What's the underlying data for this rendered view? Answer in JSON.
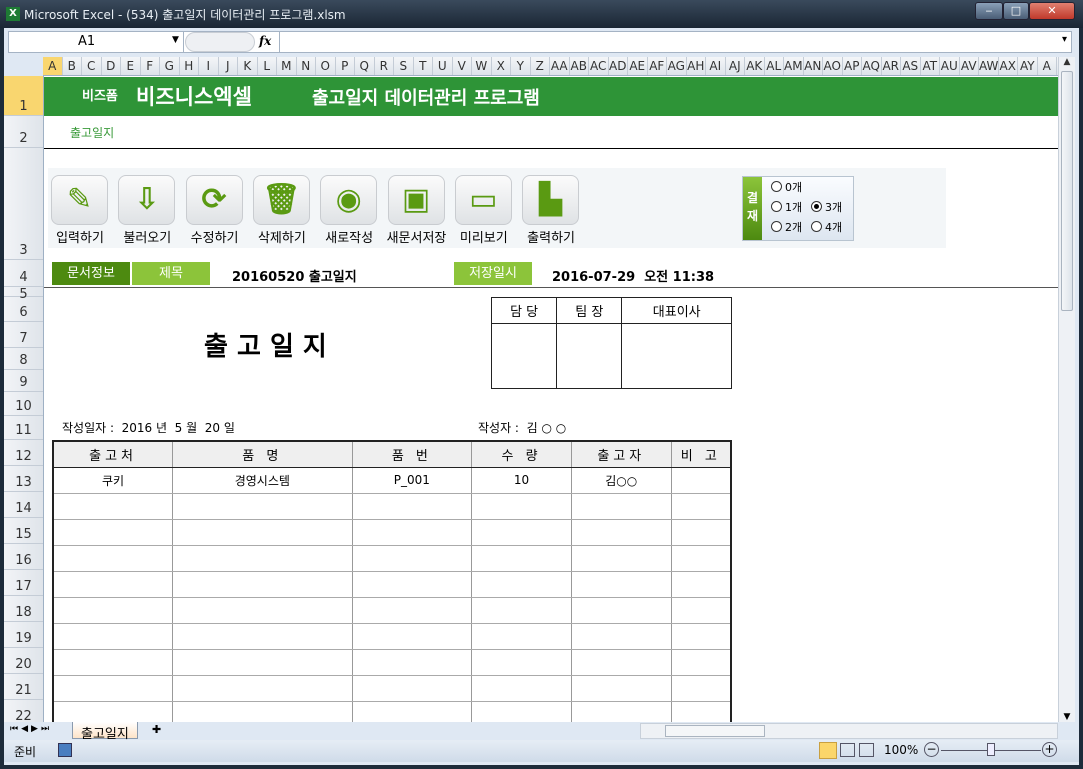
{
  "window": {
    "title": "Microsoft Excel - (534) 출고일지 데이터관리 프로그램.xlsm",
    "app_icon": "X"
  },
  "formula_bar": {
    "name_box": "A1",
    "fx": "fx",
    "formula": ""
  },
  "columns": [
    "A",
    "B",
    "C",
    "D",
    "E",
    "F",
    "G",
    "H",
    "I",
    "J",
    "K",
    "L",
    "M",
    "N",
    "O",
    "P",
    "Q",
    "R",
    "S",
    "T",
    "U",
    "V",
    "W",
    "X",
    "Y",
    "Z",
    "AA",
    "AB",
    "AC",
    "AD",
    "AE",
    "AF",
    "AG",
    "AH",
    "AI",
    "AJ",
    "AK",
    "AL",
    "AM",
    "AN",
    "AO",
    "AP",
    "AQ",
    "AR",
    "AS",
    "AT",
    "AU",
    "AV",
    "AW",
    "AX",
    "AY",
    "A"
  ],
  "rows": [
    "1",
    "2",
    "3",
    "4",
    "5",
    "6",
    "7",
    "8",
    "9",
    "10",
    "11",
    "12",
    "13",
    "14",
    "15",
    "16",
    "17",
    "18",
    "19",
    "20",
    "21",
    "22"
  ],
  "banner": {
    "brand_small": "비즈폼",
    "brand": "비즈니스엑셀",
    "program": "출고일지 데이터관리 프로그램"
  },
  "sheet_label": "출고일지",
  "toolbar": [
    {
      "label": "입력하기",
      "icon": "pencil-icon"
    },
    {
      "label": "불러오기",
      "icon": "load-icon"
    },
    {
      "label": "수정하기",
      "icon": "refresh-icon"
    },
    {
      "label": "삭제하기",
      "icon": "trash-icon"
    },
    {
      "label": "새로작성",
      "icon": "new-icon"
    },
    {
      "label": "새문서저장",
      "icon": "save-icon"
    },
    {
      "label": "미리보기",
      "icon": "monitor-icon"
    },
    {
      "label": "출력하기",
      "icon": "print-icon"
    }
  ],
  "approval_option": {
    "label": "결재",
    "options": [
      "0개",
      "1개",
      "3개",
      "2개",
      "4개"
    ],
    "selected": "3개"
  },
  "doc_info": {
    "label": "문서정보",
    "title_label": "제목",
    "title": "20160520 출고일지",
    "saved_label": "저장일시",
    "saved": "2016-07-29  오전 11:38"
  },
  "doc": {
    "heading": "출 고 일 지",
    "approval_headers": [
      "담 당",
      "팀 장",
      "대표이사"
    ],
    "date_line": "작성일자 :  2016 년  5 월  20 일",
    "author_line": "작성자 :  김 ○ ○"
  },
  "table": {
    "headers": [
      "출고처",
      "품  명",
      "품  번",
      "수  량",
      "출고자",
      "비 고"
    ],
    "rows": [
      [
        "쿠키",
        "경영시스템",
        "P_001",
        "10",
        "김○○",
        ""
      ]
    ]
  },
  "sheet_tabs": [
    "출고일지"
  ],
  "status": {
    "ready": "준비",
    "zoom": "100%"
  }
}
